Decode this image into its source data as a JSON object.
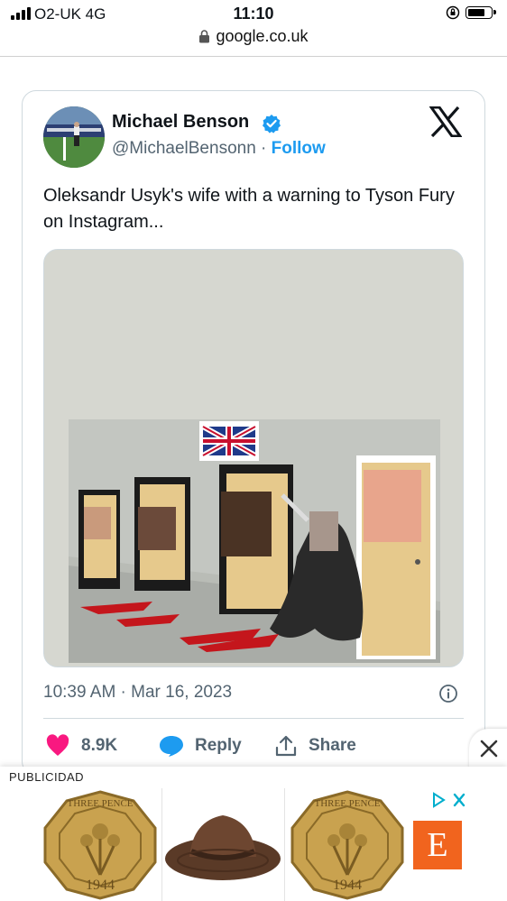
{
  "status_bar": {
    "carrier": "O2-UK  4G",
    "time": "11:10"
  },
  "browser": {
    "url": "google.co.uk"
  },
  "tweet": {
    "author_name": "Michael Benson",
    "handle": "@MichaelBensonn",
    "separator": "·",
    "follow_label": "Follow",
    "text": "Oleksandr Usyk's wife with a warning to Tyson Fury on Instagram...",
    "timestamp": "10:39 AM · Mar 16, 2023",
    "likes": "8.9K",
    "reply_label": "Reply",
    "share_label": "Share"
  },
  "ad": {
    "label": "PUBLICIDAD",
    "coin_text": "THREE PENCE",
    "coin_year": "1944",
    "etsy_letter": "E"
  },
  "colors": {
    "accent": "#1d9bf0",
    "like": "#f91880",
    "etsy": "#f1641e",
    "text_secondary": "#536471"
  },
  "icons": [
    "signal-icon",
    "orientation-lock-icon",
    "battery-icon",
    "lock-icon",
    "verified-badge-icon",
    "x-logo-icon",
    "info-icon",
    "heart-icon",
    "reply-icon",
    "share-icon",
    "close-icon",
    "adchoices-icon"
  ]
}
